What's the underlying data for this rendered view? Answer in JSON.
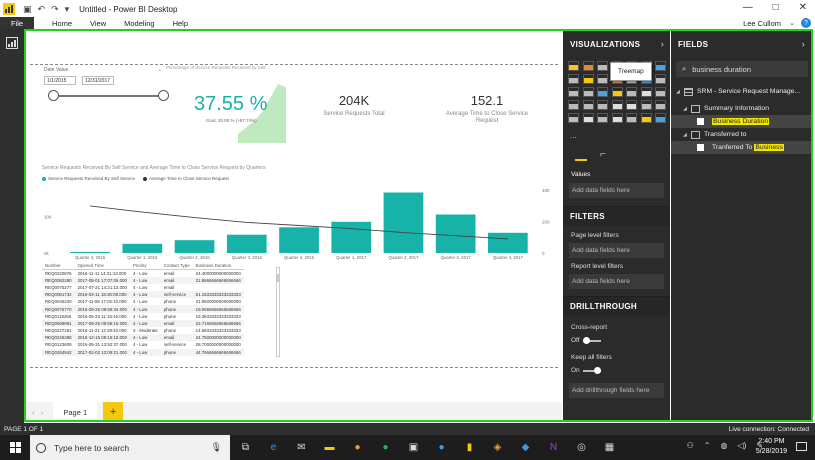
{
  "window": {
    "title": "Untitled - Power BI Desktop",
    "controls": [
      "—",
      "□",
      "✕"
    ]
  },
  "menu": {
    "file": "File",
    "items": [
      "Home",
      "View",
      "Modeling",
      "Help"
    ],
    "user": "Lee Cullom"
  },
  "report": {
    "slicer": {
      "title": "Date Value",
      "start": "1/1/2015",
      "end": "12/31/2017",
      "range": [
        0,
        1
      ]
    },
    "kpi": {
      "title": "Percentage of Service Requests Received by Self...",
      "value": "37.55 %",
      "goal_text": "Goal: 20.00 % (+87.74%)",
      "trend": [
        0.15,
        0.25,
        0.35,
        0.5,
        0.72,
        0.95,
        0.9
      ],
      "accent": "#17b2a8"
    },
    "cards": [
      {
        "value": "204K",
        "label": "Service Requests Total"
      },
      {
        "value": "152.1",
        "label": "Average Time to Close Service Request"
      }
    ],
    "combo": {
      "title": "Service Requests Received By Self Service and Average Time to Close Service Request by Quarters",
      "legend": [
        "Service Requests Received By Self Service",
        "Average Time to Close Service Request"
      ]
    },
    "table": {
      "columns": [
        "Number",
        "Opened Time",
        "Priority",
        "Contact Type",
        "Business Duration"
      ],
      "rows": [
        [
          "REQ0220876",
          "2016-11-11 14:21:13.000",
          "4 - Low",
          "email",
          "24.4000000000000000"
        ],
        [
          "REQ0082280",
          "2017-08-01 17:07:06.000",
          "4 - Low",
          "email",
          "21.8666666666666666"
        ],
        [
          "REQ0075277",
          "2017-07-21 14:21:13.000",
          "4 - Low",
          "email",
          ""
        ],
        [
          "REQ0081734",
          "2016-02-11 18:30:08.000",
          "4 - Low",
          "self-service",
          "61.1833333333333333"
        ],
        [
          "REQ0045220",
          "2017-11-08 17:02:10.000",
          "4 - Low",
          "phone",
          "21.9500000000000000"
        ],
        [
          "REQ0076770",
          "2016-08-26 09:59:34.000",
          "4 - Low",
          "phone",
          "19.0666666666666666"
        ],
        [
          "REQ0119266",
          "2016-05-22 11:15:45.000",
          "4 - Low",
          "phone",
          "19.3833333333333333"
        ],
        [
          "REQ0069091",
          "2017-08-25 09:58:15.000",
          "4 - Low",
          "email",
          "22.7166666666666666"
        ],
        [
          "REQ0227291",
          "2016-11-21 12:29:40.000",
          "3 - Moderate",
          "phone",
          "14.5833333333333333"
        ],
        [
          "REQ0226388",
          "2016-12-15 09:15:10.000",
          "4 - Low",
          "email",
          "24.7500000000000000"
        ],
        [
          "REQ0123609",
          "2016-05-31 13:52:37.000",
          "4 - Low",
          "self-service",
          "28.7000000000000000"
        ],
        [
          "REQ0264942",
          "2017-02-02 12:09:21.000",
          "4 - Low",
          "phone",
          "44.7666666666666666"
        ]
      ]
    }
  },
  "chart_data": {
    "type": "bar",
    "title": "Service Requests Received By Self Service and Average Time to Close Service Request by Quarters",
    "categories": [
      "Quarter 4, 2015",
      "Quarter 1, 2016",
      "Quarter 2, 2016",
      "Quarter 3, 2016",
      "Quarter 4, 2016",
      "Quarter 1, 2017",
      "Quarter 2, 2017",
      "Quarter 3, 2017",
      "Quarter 4, 2017"
    ],
    "series": [
      {
        "name": "Service Requests Received By Self Service",
        "kind": "bar",
        "axis": "left",
        "values": [
          0.3,
          2.5,
          3.5,
          5,
          7,
          8.5,
          16.5,
          10.5,
          5.5
        ],
        "color": "#17b2a8"
      },
      {
        "name": "Average Time to Close Service Request",
        "kind": "line",
        "axis": "right",
        "values": [
          300,
          260,
          225,
          195,
          175,
          155,
          130,
          110,
          90
        ],
        "color": "#444444"
      }
    ],
    "left_ticks": [
      "0k",
      "10K"
    ],
    "right_ticks": [
      "0",
      "200",
      "400"
    ],
    "ylim_left": [
      0,
      18
    ],
    "ylim_right": [
      0,
      420
    ]
  },
  "pages": {
    "tab": "Page 1",
    "add": "+"
  },
  "visualizations": {
    "header": "VISUALIZATIONS",
    "tooltip": "Treemap",
    "more": "...",
    "values_label": "Values",
    "add_data": "Add data fields here",
    "filters_header": "FILTERS",
    "page_filters": "Page level filters",
    "report_filters": "Report level filters",
    "drill_header": "DRILLTHROUGH",
    "cross_report": "Cross-report",
    "off": "Off",
    "keep_filters": "Keep all filters",
    "on": "On",
    "add_drill": "Add drillthrough fields here"
  },
  "fields": {
    "header": "FIELDS",
    "search_value": "business duration",
    "table_name": "SRM - Service Request Manage...",
    "group1": "Summary Information",
    "field1": "Business Duration",
    "group2": "Transferred to",
    "field2_prefix": "Tranferred To ",
    "field2_highlight": "Business"
  },
  "status": {
    "page": "PAGE 1 OF 1",
    "connection": "Live connection: Connected"
  },
  "taskbar": {
    "search_placeholder": "Type here to search",
    "time": "2:40 PM",
    "date": "5/28/2019"
  }
}
